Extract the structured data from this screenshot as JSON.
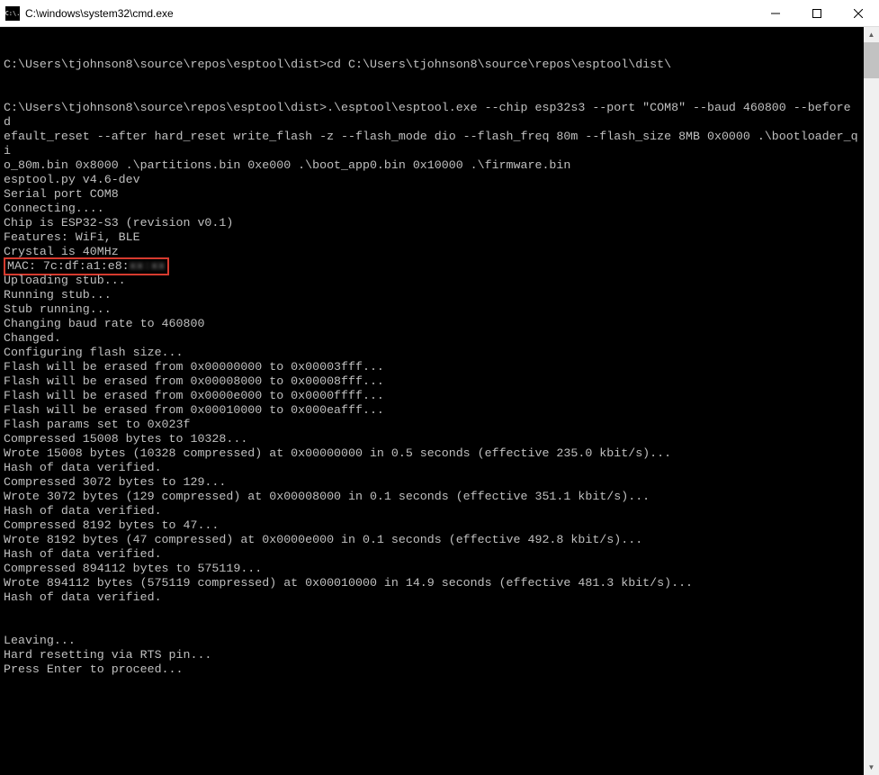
{
  "window": {
    "title": "C:\\windows\\system32\\cmd.exe",
    "icon_text": "C:\\."
  },
  "terminal": {
    "prompt1_path": "C:\\Users\\tjohnson8\\source\\repos\\esptool\\dist>",
    "cmd1": "cd C:\\Users\\tjohnson8\\source\\repos\\esptool\\dist\\",
    "prompt2_path": "C:\\Users\\tjohnson8\\source\\repos\\esptool\\dist>",
    "cmd2_line1": ".\\esptool\\esptool.exe --chip esp32s3 --port \"COM8\" --baud 460800 --before d",
    "cmd2_line2": "efault_reset --after hard_reset write_flash -z --flash_mode dio --flash_freq 80m --flash_size 8MB 0x0000 .\\bootloader_qi",
    "cmd2_line3": "o_80m.bin 0x8000 .\\partitions.bin 0xe000 .\\boot_app0.bin 0x10000 .\\firmware.bin",
    "out": {
      "l1": "esptool.py v4.6-dev",
      "l2": "Serial port COM8",
      "l3": "Connecting....",
      "l4": "Chip is ESP32-S3 (revision v0.1)",
      "l5": "Features: WiFi, BLE",
      "l6": "Crystal is 40MHz",
      "mac_highlight": "MAC: 7c:df:a1:e8:",
      "mac_tail": "",
      "l8": "Uploading stub...",
      "l9": "Running stub...",
      "l10": "Stub running...",
      "l11": "Changing baud rate to 460800",
      "l12": "Changed.",
      "l13": "Configuring flash size...",
      "l14": "Flash will be erased from 0x00000000 to 0x00003fff...",
      "l15": "Flash will be erased from 0x00008000 to 0x00008fff...",
      "l16": "Flash will be erased from 0x0000e000 to 0x0000ffff...",
      "l17": "Flash will be erased from 0x00010000 to 0x000eafff...",
      "l18": "Flash params set to 0x023f",
      "l19": "Compressed 15008 bytes to 10328...",
      "l20": "Wrote 15008 bytes (10328 compressed) at 0x00000000 in 0.5 seconds (effective 235.0 kbit/s)...",
      "l21": "Hash of data verified.",
      "l22": "Compressed 3072 bytes to 129...",
      "l23": "Wrote 3072 bytes (129 compressed) at 0x00008000 in 0.1 seconds (effective 351.1 kbit/s)...",
      "l24": "Hash of data verified.",
      "l25": "Compressed 8192 bytes to 47...",
      "l26": "Wrote 8192 bytes (47 compressed) at 0x0000e000 in 0.1 seconds (effective 492.8 kbit/s)...",
      "l27": "Hash of data verified.",
      "l28": "Compressed 894112 bytes to 575119...",
      "l29": "Wrote 894112 bytes (575119 compressed) at 0x00010000 in 14.9 seconds (effective 481.3 kbit/s)...",
      "l30": "Hash of data verified.",
      "l31": "Leaving...",
      "l32": "Hard resetting via RTS pin...",
      "l33": "Press Enter to proceed..."
    }
  }
}
